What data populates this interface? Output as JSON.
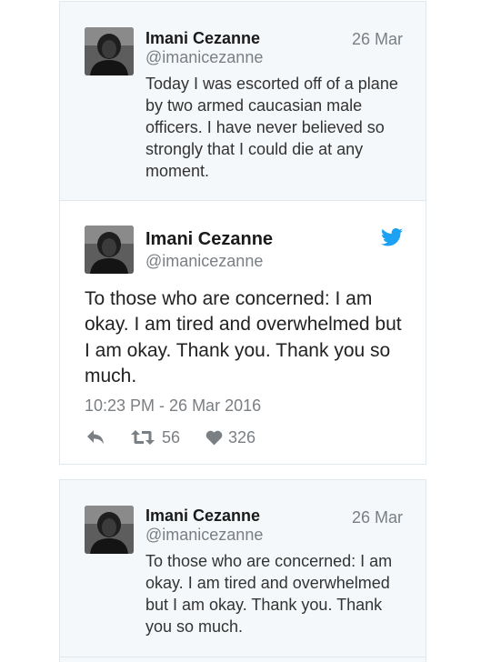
{
  "colors": {
    "accent": "#1da1f2",
    "muted": "#7a7f84",
    "card_grey": "#f5f8fa",
    "border": "#e1e8ed"
  },
  "tweet1": {
    "name": "Imani Cezanne",
    "handle": "@imanicezanne",
    "date": "26 Mar",
    "text": "Today I was escorted off of a plane by two armed caucasian male officers. I have never believed so strongly that I could die at any moment."
  },
  "tweet2": {
    "name": "Imani Cezanne",
    "handle": "@imanicezanne",
    "bird_icon": "twitter-bird-icon",
    "text": "To those who are concerned: I am okay. I am tired and overwhelmed but I am okay. Thank you. Thank you so much.",
    "timestamp": "10:23 PM - 26 Mar 2016",
    "actions": {
      "reply_icon": "reply-icon",
      "retweet_icon": "retweet-icon",
      "retweets": "56",
      "like_icon": "heart-icon",
      "likes": "326"
    }
  },
  "tweet3": {
    "name": "Imani Cezanne",
    "handle": "@imanicezanne",
    "date": "26 Mar",
    "text": "To those who are concerned: I am okay. I am tired and overwhelmed but I am okay. Thank you. Thank you so much."
  }
}
